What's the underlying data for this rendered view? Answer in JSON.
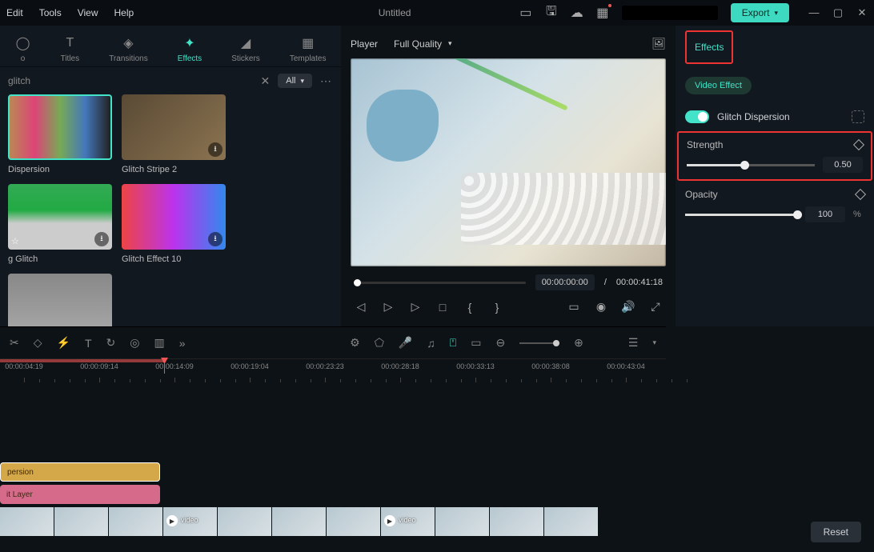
{
  "menu": {
    "edit": "Edit",
    "tools": "Tools",
    "view": "View",
    "help": "Help"
  },
  "title": "Untitled",
  "export": "Export",
  "tabs": [
    {
      "label": "Titles",
      "icon": "T"
    },
    {
      "label": "Transitions",
      "icon": "◈"
    },
    {
      "label": "Effects",
      "icon": "✦",
      "active": true
    },
    {
      "label": "Stickers",
      "icon": "◢"
    },
    {
      "label": "Templates",
      "icon": "▦"
    }
  ],
  "search": {
    "query": "glitch",
    "filter": "All"
  },
  "cards": [
    {
      "name": "Dispersion",
      "cls": "th1",
      "sel": true
    },
    {
      "name": "Glitch Stripe 2",
      "cls": "th2",
      "dl": true
    },
    {
      "name": "g Glitch",
      "cls": "th3",
      "dl": true,
      "star": true
    },
    {
      "name": "Glitch Effect 10",
      "cls": "th4",
      "dl": true
    },
    {
      "name": "",
      "cls": "th5"
    }
  ],
  "player": {
    "label": "Player",
    "quality": "Full Quality",
    "cur": "00:00:00:00",
    "dur": "00:00:41:18"
  },
  "right": {
    "tab": "Effects",
    "chip": "Video Effect",
    "toggle": "Glitch Dispersion",
    "strength": {
      "label": "Strength",
      "value": "0.50",
      "pct": 45
    },
    "opacity": {
      "label": "Opacity",
      "value": "100",
      "unit": "%",
      "pct": 100
    },
    "reset": "Reset"
  },
  "ruler": [
    "00:00:04:19",
    "00:00:09:14",
    "00:00:14:09",
    "00:00:19:04",
    "00:00:23:23",
    "00:00:28:18",
    "00:00:33:13",
    "00:00:38:08",
    "00:00:43:04"
  ],
  "clips": {
    "fx": "persion",
    "adj": "it Layer",
    "video": "video"
  }
}
